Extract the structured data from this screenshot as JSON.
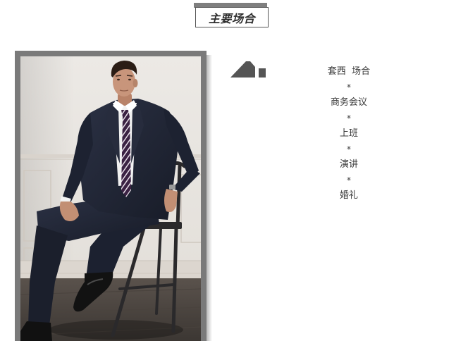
{
  "header": {
    "title": "主要场合"
  },
  "occasions": {
    "heading": "套西  场合",
    "separator": "*",
    "items": [
      "商务会议",
      "上班",
      "演讲",
      "婚礼"
    ]
  },
  "icons": {
    "occasion_marker": "slope-step-icon"
  },
  "colors": {
    "frame": "#7a7a7a",
    "header_bar": "#7f7f7f",
    "header_border": "#555555",
    "text": "#3a3a3a",
    "icon": "#555555",
    "background": "#ffffff"
  }
}
